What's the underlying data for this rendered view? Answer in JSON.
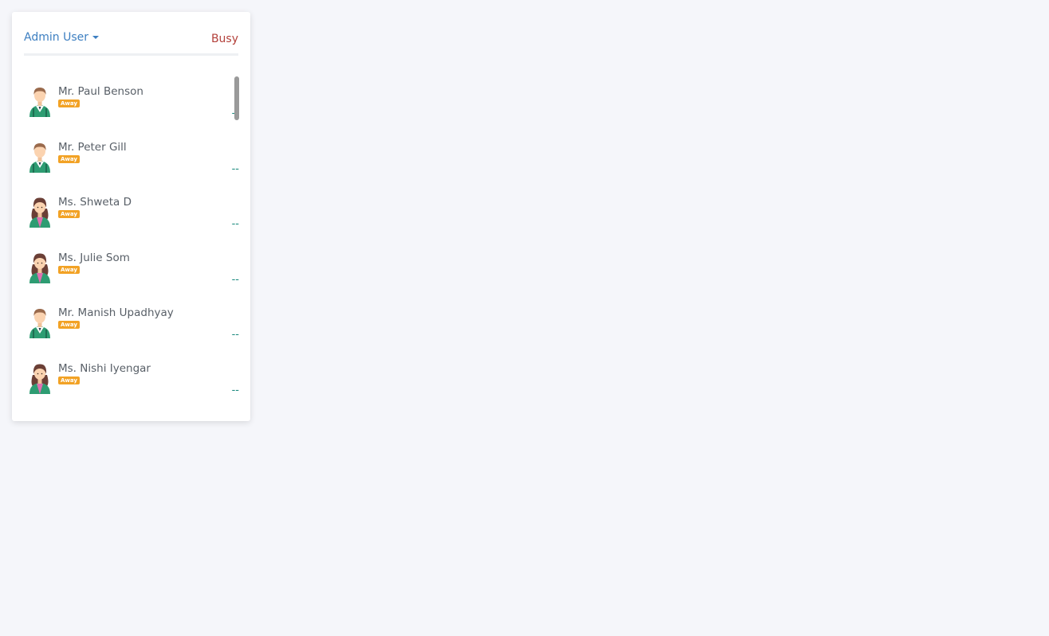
{
  "header": {
    "user_label": "Admin User",
    "status_label": "Busy"
  },
  "contacts": [
    {
      "name": "Mr. Paul Benson",
      "status": "Away",
      "last": "--",
      "avatar": "male-avatar-icon"
    },
    {
      "name": "Mr. Peter Gill",
      "status": "Away",
      "last": "--",
      "avatar": "male-avatar-icon"
    },
    {
      "name": "Ms. Shweta D",
      "status": "Away",
      "last": "--",
      "avatar": "female-avatar-icon"
    },
    {
      "name": "Ms. Julie Som",
      "status": "Away",
      "last": "--",
      "avatar": "female-avatar-icon"
    },
    {
      "name": "Mr. Manish Upadhyay",
      "status": "Away",
      "last": "--",
      "avatar": "male-avatar-icon"
    },
    {
      "name": "Ms. Nishi Iyengar",
      "status": "Away",
      "last": "--",
      "avatar": "female-avatar-icon"
    }
  ],
  "colors": {
    "link": "#3d7fc1",
    "busy": "#b3403a",
    "away_badge": "#f2a225",
    "last_seen": "#1b8a7e"
  }
}
